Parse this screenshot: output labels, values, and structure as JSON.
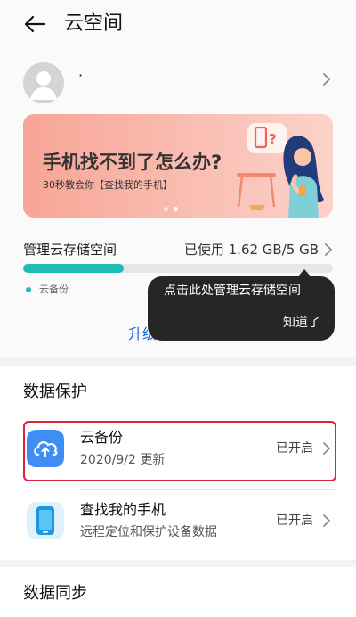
{
  "header": {
    "title": "云空间"
  },
  "account": {
    "name": "·"
  },
  "banner": {
    "title": "手机找不到了怎么办?",
    "subtitle": "30秒教会你【查找我的手机】",
    "pages": 2,
    "active_page": 2
  },
  "storage": {
    "label": "管理云存储空间",
    "used": "已使用 1.62 GB/5 GB",
    "used_fraction": 0.324,
    "legend_label": "云备份",
    "upgrade_label": "升级云存储空间"
  },
  "tooltip": {
    "text": "点击此处管理云存储空间",
    "button": "知道了"
  },
  "data_protection": {
    "title": "数据保护",
    "items": [
      {
        "title": "云备份",
        "subtitle": "2020/9/2 更新",
        "status": "已开启",
        "icon": "cloud-backup-icon"
      },
      {
        "title": "查找我的手机",
        "subtitle": "远程定位和保护设备数据",
        "status": "已开启",
        "icon": "find-phone-icon"
      }
    ]
  },
  "data_sync": {
    "title": "数据同步"
  },
  "colors": {
    "accent": "#1dbdb6",
    "link": "#1966d6",
    "highlight": "#d8233a",
    "tooltip_bg": "#262626"
  }
}
